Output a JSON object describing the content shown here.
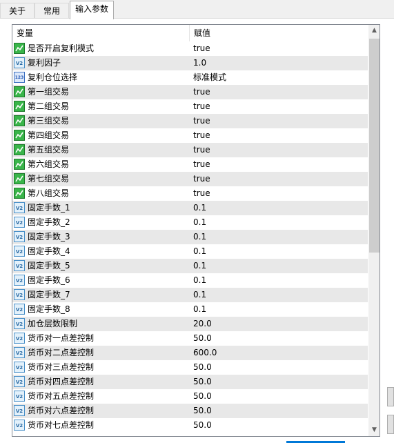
{
  "tabs": [
    {
      "label": "关于"
    },
    {
      "label": "常用"
    },
    {
      "label": "输入参数"
    }
  ],
  "table": {
    "columns": [
      "变量",
      "赋值"
    ],
    "rows": [
      {
        "icon": "bool",
        "icon_text": "",
        "name": "是否开启复利模式",
        "value": "true"
      },
      {
        "icon": "num",
        "icon_text": "V2",
        "name": "复利因子",
        "value": "1.0"
      },
      {
        "icon": "enum",
        "icon_text": "123",
        "name": "复利仓位选择",
        "value": "标准模式"
      },
      {
        "icon": "bool",
        "icon_text": "",
        "name": "第一组交易",
        "value": "true"
      },
      {
        "icon": "bool",
        "icon_text": "",
        "name": "第二组交易",
        "value": "true"
      },
      {
        "icon": "bool",
        "icon_text": "",
        "name": "第三组交易",
        "value": "true"
      },
      {
        "icon": "bool",
        "icon_text": "",
        "name": "第四组交易",
        "value": "true"
      },
      {
        "icon": "bool",
        "icon_text": "",
        "name": "第五组交易",
        "value": "true"
      },
      {
        "icon": "bool",
        "icon_text": "",
        "name": "第六组交易",
        "value": "true"
      },
      {
        "icon": "bool",
        "icon_text": "",
        "name": "第七组交易",
        "value": "true"
      },
      {
        "icon": "bool",
        "icon_text": "",
        "name": "第八组交易",
        "value": "true"
      },
      {
        "icon": "num",
        "icon_text": "V2",
        "name": "固定手数_1",
        "value": "0.1"
      },
      {
        "icon": "num",
        "icon_text": "V2",
        "name": "固定手数_2",
        "value": "0.1"
      },
      {
        "icon": "num",
        "icon_text": "V2",
        "name": "固定手数_3",
        "value": "0.1"
      },
      {
        "icon": "num",
        "icon_text": "V2",
        "name": "固定手数_4",
        "value": "0.1"
      },
      {
        "icon": "num",
        "icon_text": "V2",
        "name": "固定手数_5",
        "value": "0.1"
      },
      {
        "icon": "num",
        "icon_text": "V2",
        "name": "固定手数_6",
        "value": "0.1"
      },
      {
        "icon": "num",
        "icon_text": "V2",
        "name": "固定手数_7",
        "value": "0.1"
      },
      {
        "icon": "num",
        "icon_text": "V2",
        "name": "固定手数_8",
        "value": "0.1"
      },
      {
        "icon": "num",
        "icon_text": "V2",
        "name": "加仓层数限制",
        "value": "20.0"
      },
      {
        "icon": "num",
        "icon_text": "V2",
        "name": "货币对一点差控制",
        "value": "50.0"
      },
      {
        "icon": "num",
        "icon_text": "V2",
        "name": "货币对二点差控制",
        "value": "600.0"
      },
      {
        "icon": "num",
        "icon_text": "V2",
        "name": "货币对三点差控制",
        "value": "50.0"
      },
      {
        "icon": "num",
        "icon_text": "V2",
        "name": "货币对四点差控制",
        "value": "50.0"
      },
      {
        "icon": "num",
        "icon_text": "V2",
        "name": "货币对五点差控制",
        "value": "50.0"
      },
      {
        "icon": "num",
        "icon_text": "V2",
        "name": "货币对六点差控制",
        "value": "50.0"
      },
      {
        "icon": "num",
        "icon_text": "V2",
        "name": "货币对七点差控制",
        "value": "50.0"
      }
    ]
  },
  "scrollbar": {
    "up_icon": "chevron-up-icon",
    "down_icon": "chevron-down-icon"
  },
  "colors": {
    "accent": "#0078d7",
    "alt_row": "#e8e8e8",
    "bool_icon": "#39b54a"
  }
}
